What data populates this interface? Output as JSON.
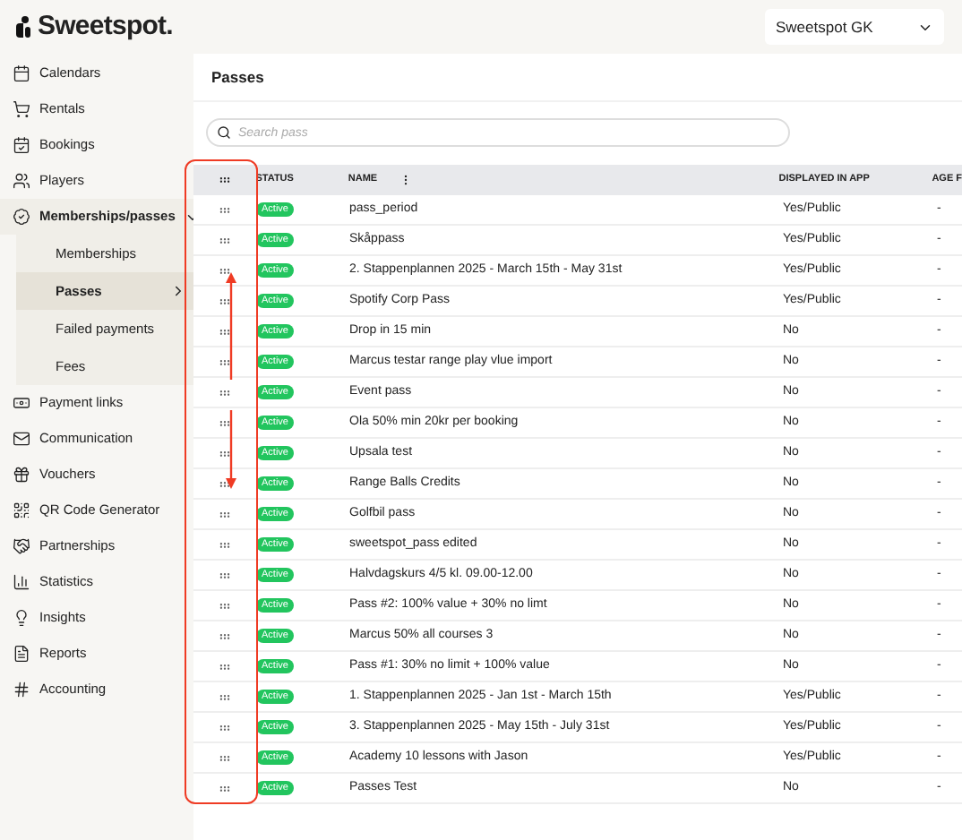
{
  "logo": "Sweetspot.",
  "org_select": {
    "value": "Sweetspot GK"
  },
  "sidebar": {
    "items": [
      {
        "label": "Calendars",
        "selected": false
      },
      {
        "label": "Rentals",
        "selected": false
      },
      {
        "label": "Bookings",
        "selected": false
      },
      {
        "label": "Players",
        "selected": false
      },
      {
        "label": "Memberships/passes",
        "selected": true,
        "expanded": true,
        "children": [
          {
            "label": "Memberships",
            "selected": false
          },
          {
            "label": "Passes",
            "selected": true
          },
          {
            "label": "Failed payments",
            "selected": false
          },
          {
            "label": "Fees",
            "selected": false
          }
        ]
      },
      {
        "label": "Payment links",
        "selected": false
      },
      {
        "label": "Communication",
        "selected": false
      },
      {
        "label": "Vouchers",
        "selected": false
      },
      {
        "label": "QR Code Generator",
        "selected": false
      },
      {
        "label": "Partnerships",
        "selected": false
      },
      {
        "label": "Statistics",
        "selected": false
      },
      {
        "label": "Insights",
        "selected": false
      },
      {
        "label": "Reports",
        "selected": false
      },
      {
        "label": "Accounting",
        "selected": false
      }
    ]
  },
  "page_title": "Passes",
  "search": {
    "placeholder": "Search pass"
  },
  "table": {
    "columns": [
      "STATUS",
      "NAME",
      "DISPLAYED IN APP",
      "AGE F"
    ],
    "rows": [
      {
        "status": "Active",
        "name": "pass_period",
        "displayed": "Yes/Public",
        "column_5": "-"
      },
      {
        "status": "Active",
        "name": "Skåppass",
        "displayed": "Yes/Public",
        "column_5": "-"
      },
      {
        "status": "Active",
        "name": "2. Stappenplannen 2025 - March 15th - May 31st",
        "displayed": "Yes/Public",
        "column_5": "-"
      },
      {
        "status": "Active",
        "name": "Spotify Corp Pass",
        "displayed": "Yes/Public",
        "column_5": "-"
      },
      {
        "status": "Active",
        "name": "Drop in 15 min",
        "displayed": "No",
        "column_5": "-"
      },
      {
        "status": "Active",
        "name": "Marcus testar range play vlue import",
        "displayed": "No",
        "column_5": "-"
      },
      {
        "status": "Active",
        "name": "Event pass",
        "displayed": "No",
        "column_5": "-"
      },
      {
        "status": "Active",
        "name": "Ola 50% min 20kr per booking",
        "displayed": "No",
        "column_5": "-"
      },
      {
        "status": "Active",
        "name": "Upsala test",
        "displayed": "No",
        "column_5": "-"
      },
      {
        "status": "Active",
        "name": "Range Balls Credits",
        "displayed": "No",
        "column_5": "-"
      },
      {
        "status": "Active",
        "name": "Golfbil pass",
        "displayed": "No",
        "column_5": "-"
      },
      {
        "status": "Active",
        "name": "sweetspot_pass edited",
        "displayed": "No",
        "column_5": "-"
      },
      {
        "status": "Active",
        "name": "Halvdagskurs 4/5 kl. 09.00-12.00",
        "displayed": "No",
        "column_5": "-"
      },
      {
        "status": "Active",
        "name": "Pass #2: 100% value + 30% no limt",
        "displayed": "No",
        "column_5": "-"
      },
      {
        "status": "Active",
        "name": "Marcus 50% all courses 3",
        "displayed": "No",
        "column_5": "-"
      },
      {
        "status": "Active",
        "name": "Pass #1: 30% no limit + 100% value",
        "displayed": "No",
        "column_5": "-"
      },
      {
        "status": "Active",
        "name": "1. Stappenplannen 2025 - Jan 1st - March 15th",
        "displayed": "Yes/Public",
        "column_5": "-"
      },
      {
        "status": "Active",
        "name": "3. Stappenplannen 2025 - May 15th - July 31st",
        "displayed": "Yes/Public",
        "column_5": "-"
      },
      {
        "status": "Active",
        "name": "Academy 10 lessons with Jason",
        "displayed": "Yes/Public",
        "column_5": "-"
      },
      {
        "status": "Active",
        "name": "Passes Test",
        "displayed": "No",
        "column_5": "-"
      }
    ]
  }
}
